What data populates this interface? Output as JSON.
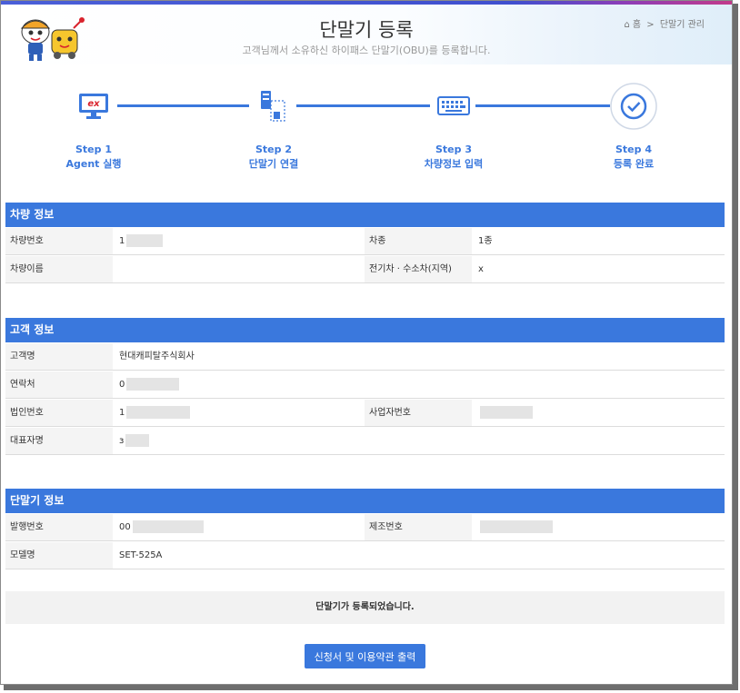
{
  "header": {
    "title": "단말기 등록",
    "subtitle": "고객님께서 소유하신 하이패스 단말기(OBU)를 등록합니다.",
    "breadcrumb": {
      "home": "홈",
      "separator": ">",
      "current": "단말기 관리"
    }
  },
  "steps": [
    {
      "step": "Step 1",
      "label": "Agent 실행"
    },
    {
      "step": "Step 2",
      "label": "단말기 연결"
    },
    {
      "step": "Step 3",
      "label": "차량정보 입력"
    },
    {
      "step": "Step 4",
      "label": "등록 완료"
    }
  ],
  "vehicle": {
    "title": "차량 정보",
    "plate_label": "차량번호",
    "plate_value": "1",
    "type_label": "차종",
    "type_value": "1종",
    "name_label": "차량이름",
    "name_value": "",
    "ev_label": "전기차 · 수소차(지역)",
    "ev_value": "x"
  },
  "customer": {
    "title": "고객 정보",
    "name_label": "고객명",
    "name_value": "현대캐피탈주식회사",
    "contact_label": "연락처",
    "contact_value": "0",
    "corp_label": "법인번호",
    "corp_value": "1",
    "biz_label": "사업자번호",
    "biz_value": "",
    "rep_label": "대표자명",
    "rep_value": "з"
  },
  "device": {
    "title": "단말기 정보",
    "issue_label": "발행번호",
    "issue_value": "00",
    "serial_label": "제조번호",
    "serial_value": "",
    "model_label": "모델명",
    "model_value": "SET-525A"
  },
  "notice": "단말기가 등록되었습니다.",
  "print_button": "신청서 및 이용약관 출력",
  "colors": {
    "accent": "#3a78dd",
    "ex_logo": "#d9232d"
  }
}
